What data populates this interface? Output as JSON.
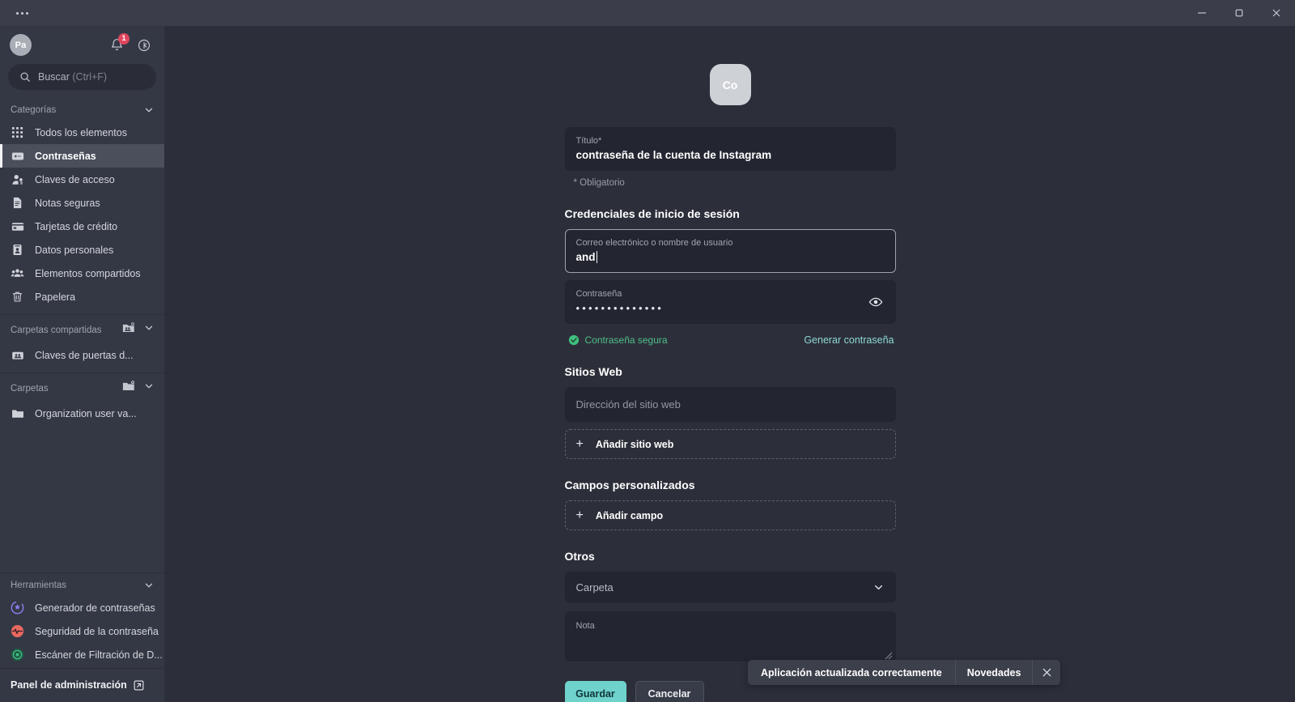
{
  "window": {
    "menu_icon": "more-horizontal-icon",
    "minimize_label": "Minimizar",
    "maximize_label": "Restaurar",
    "close_label": "Cerrar"
  },
  "sidebar": {
    "avatar_initials": "Pa",
    "notifications_count": "1",
    "notifications_icon": "bell-icon",
    "settings_icon": "gear-icon",
    "search": {
      "icon": "search-icon",
      "label": "Buscar",
      "shortcut": "(Ctrl+F)",
      "placeholder": "Buscar (Ctrl+F)"
    },
    "categories": {
      "title": "Categorías",
      "collapse_icon": "chevron-down-icon",
      "items": [
        {
          "label": "Todos los elementos",
          "icon": "grid-icon",
          "active": false
        },
        {
          "label": "Contraseñas",
          "icon": "password-card-icon",
          "active": true
        },
        {
          "label": "Claves de acceso",
          "icon": "passkey-person-icon",
          "active": false
        },
        {
          "label": "Notas seguras",
          "icon": "note-icon",
          "active": false
        },
        {
          "label": "Tarjetas de crédito",
          "icon": "credit-card-icon",
          "active": false
        },
        {
          "label": "Datos personales",
          "icon": "id-card-icon",
          "active": false
        },
        {
          "label": "Elementos compartidos",
          "icon": "people-icon",
          "active": false
        },
        {
          "label": "Papelera",
          "icon": "trash-icon",
          "active": false
        }
      ]
    },
    "shared_folders": {
      "title": "Carpetas compartidas",
      "add_icon": "add-shared-folder-icon",
      "collapse_icon": "chevron-down-icon",
      "items": [
        {
          "label": "Claves de puertas d...",
          "icon": "shared-folder-icon"
        }
      ]
    },
    "folders": {
      "title": "Carpetas",
      "add_icon": "add-folder-icon",
      "collapse_icon": "chevron-down-icon",
      "items": [
        {
          "label": "Organization user va...",
          "icon": "folder-icon"
        }
      ]
    },
    "tools": {
      "title": "Herramientas",
      "collapse_icon": "chevron-down-icon",
      "items": [
        {
          "label": "Generador de contraseñas",
          "icon": "password-generator-icon",
          "color": "#8d7ff0"
        },
        {
          "label": "Seguridad de la contraseña",
          "icon": "password-health-icon",
          "color": "#e8685f"
        },
        {
          "label": "Escáner de Filtración de D...",
          "icon": "dark-web-scanner-icon",
          "color": "#3fbf87"
        }
      ]
    },
    "admin_panel": {
      "label": "Panel de administración",
      "icon": "external-link-icon"
    }
  },
  "main": {
    "logo_initials": "Co",
    "title_field": {
      "label": "Título*",
      "value": "contraseña de la cuenta de Instagram"
    },
    "required_note": "* Obligatorio",
    "credentials_section": {
      "heading": "Credenciales de inicio de sesión",
      "username_field": {
        "label": "Correo electrónico o nombre de usuario",
        "value": "and",
        "focused": true
      },
      "password_field": {
        "label": "Contraseña",
        "value": "••••••••••••••",
        "toggle_icon": "eye-icon"
      },
      "strength": {
        "icon": "check-circle-icon",
        "label": "Contraseña segura",
        "color": "#4fbf86"
      },
      "generate_link": "Generar contraseña"
    },
    "websites_section": {
      "heading": "Sitios Web",
      "url_field": {
        "placeholder": "Dirección del sitio web",
        "value": ""
      },
      "add_button": {
        "label": "Añadir sitio web",
        "icon": "plus-icon"
      }
    },
    "custom_fields_section": {
      "heading": "Campos personalizados",
      "add_button": {
        "label": "Añadir campo",
        "icon": "plus-icon"
      }
    },
    "others_section": {
      "heading": "Otros",
      "folder_select": {
        "value": "Carpeta",
        "icon": "chevron-down-icon"
      },
      "note_field": {
        "label": "Nota",
        "value": "",
        "resize_icon": "resize-grip-icon"
      }
    },
    "footer": {
      "save_label": "Guardar",
      "cancel_label": "Cancelar"
    }
  },
  "toast": {
    "message": "Aplicación actualizada correctamente",
    "action_label": "Novedades",
    "close_icon": "close-icon"
  },
  "colors": {
    "accent": "#6fd3cc",
    "background": "#2c2f3a",
    "sidebar": "#343844",
    "field": "#232631",
    "badge": "#e0465e",
    "success": "#4fbf86"
  }
}
